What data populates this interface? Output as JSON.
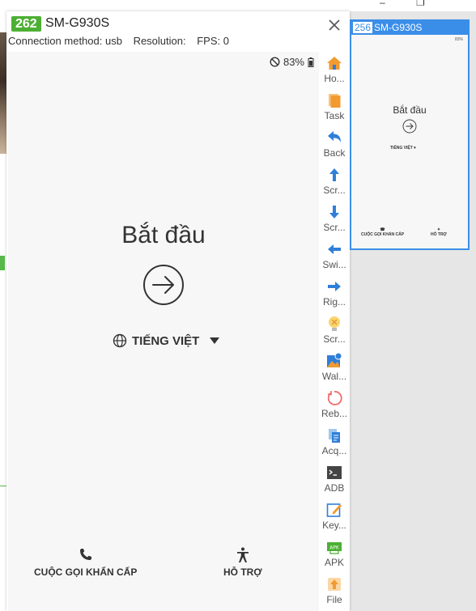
{
  "main_window": {
    "device_number": "262",
    "device_name": "SM-G930S",
    "connection": "Connection method: usb",
    "resolution": "Resolution:",
    "fps": "FPS: 0"
  },
  "phone": {
    "battery": "83%",
    "title": "Bắt đầu",
    "language": "TIẾNG VIỆT",
    "emergency_call": "CUỘC GỌI KHẨN CẤP",
    "support": "HỖ TRỢ"
  },
  "toolbar": {
    "items": [
      {
        "label": "Ho...",
        "icon": "home-icon"
      },
      {
        "label": "Task",
        "icon": "task-icon"
      },
      {
        "label": "Back",
        "icon": "back-icon"
      },
      {
        "label": "Scr...",
        "icon": "scroll-up-icon"
      },
      {
        "label": "Scr...",
        "icon": "scroll-down-icon"
      },
      {
        "label": "Swi...",
        "icon": "swipe-left-icon"
      },
      {
        "label": "Rig...",
        "icon": "swipe-right-icon"
      },
      {
        "label": "Scr...",
        "icon": "screen-toggle-icon"
      },
      {
        "label": "Wal...",
        "icon": "wallpaper-icon"
      },
      {
        "label": "Reb...",
        "icon": "reboot-icon"
      },
      {
        "label": "Acq...",
        "icon": "acquire-icon"
      },
      {
        "label": "ADB",
        "icon": "adb-icon"
      },
      {
        "label": "Key...",
        "icon": "keyboard-icon"
      },
      {
        "label": "APK",
        "icon": "apk-icon"
      },
      {
        "label": "File",
        "icon": "file-upload-icon"
      }
    ]
  },
  "thumbnail": {
    "device_number": "256",
    "device_name": "SM-G930S",
    "battery": "83%",
    "title": "Bắt đầu",
    "language": "TIẾNG VIỆT",
    "emergency_call": "CUỘC GỌI KHẨN CẤP",
    "support": "HỖ TRỢ"
  },
  "colors": {
    "badge_green": "#4caf33",
    "accent_blue": "#3b8ee8",
    "toolbar_blue": "#2f7fd8",
    "toolbar_orange": "#f29a2e"
  }
}
